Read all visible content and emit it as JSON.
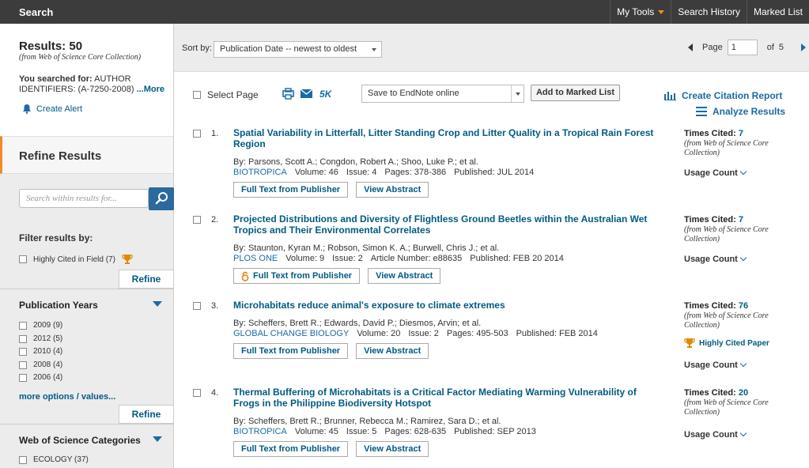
{
  "topbar": {
    "title": "Search",
    "nav": [
      {
        "label": "My Tools",
        "dropdown": true
      },
      {
        "label": "Search History",
        "dropdown": false
      },
      {
        "label": "Marked List",
        "dropdown": false
      }
    ]
  },
  "sidebar": {
    "results_title": "Results: 50",
    "results_source": "(from Web of Science Core Collection)",
    "searched_label": "You searched for:",
    "searched_query": "AUTHOR IDENTIFIERS: (A-7250-2008)",
    "more_label": "...More",
    "create_alert": "Create Alert",
    "refine_title": "Refine Results",
    "search_within_placeholder": "Search within results for...",
    "filter_title": "Filter results by:",
    "filter_items": [
      {
        "label": "Highly Cited in Field (7)",
        "checked": false
      }
    ],
    "refine_label": "Refine",
    "pub_years_title": "Publication Years",
    "pub_years": [
      {
        "label": "2009 (9)"
      },
      {
        "label": "2012 (5)"
      },
      {
        "label": "2010 (4)"
      },
      {
        "label": "2008 (4)"
      },
      {
        "label": "2006 (4)"
      }
    ],
    "more_options": "more options / values...",
    "categories_title": "Web of Science Categories",
    "categories": [
      {
        "label": "ECOLOGY (37)"
      }
    ]
  },
  "sortbar": {
    "label": "Sort by:",
    "selected": "Publication Date -- newest to oldest",
    "page_label": "Page",
    "page_value": "1",
    "of_label": "of",
    "total_pages": "5"
  },
  "toolbar": {
    "select_page": "Select Page",
    "fivek": "5K",
    "save_option": "Save to EndNote online",
    "add_marked": "Add to Marked List",
    "create_report": "Create Citation Report",
    "analyze": "Analyze Results"
  },
  "colors": {
    "link": "#005a84",
    "accent": "#f08a24",
    "topbar": "#3c3c3c"
  },
  "results": [
    {
      "num": "1.",
      "title": "Spatial Variability in Litterfall, Litter Standing Crop and Litter Quality in a Tropical Rain Forest Region",
      "authors": "By: Parsons, Scott A.; Congdon, Robert A.; Shoo, Luke P.; et al.",
      "journal": "BIOTROPICA",
      "details": [
        "Volume: 46",
        "Issue: 4",
        "Pages: 378-386",
        "Published: JUL 2014"
      ],
      "fulltext": "Full Text from Publisher",
      "abstract": "View Abstract",
      "open_access": false,
      "times_cited_label": "Times Cited:",
      "times_cited": "7",
      "cited_source": "(from Web of Science Core Collection)",
      "highly_cited": "",
      "usage": "Usage Count"
    },
    {
      "num": "2.",
      "title": "Projected Distributions and Diversity of Flightless Ground Beetles within the Australian Wet Tropics and Their Environmental Correlates",
      "authors": "By: Staunton, Kyran M.; Robson, Simon K. A.; Burwell, Chris J.; et al.",
      "journal": "PLOS ONE",
      "details": [
        "Volume: 9",
        "Issue: 2",
        "Article Number: e88635",
        "Published: FEB 20 2014"
      ],
      "fulltext": "Full Text from Publisher",
      "abstract": "View Abstract",
      "open_access": true,
      "times_cited_label": "Times Cited:",
      "times_cited": "7",
      "cited_source": "(from Web of Science Core Collection)",
      "highly_cited": "",
      "usage": "Usage Count"
    },
    {
      "num": "3.",
      "title": "Microhabitats reduce animal's exposure to climate extremes",
      "authors": "By: Scheffers, Brett R.; Edwards, David P.; Diesmos, Arvin; et al.",
      "journal": "GLOBAL CHANGE BIOLOGY",
      "details": [
        "Volume: 20",
        "Issue: 2",
        "Pages: 495-503",
        "Published: FEB 2014"
      ],
      "fulltext": "Full Text from Publisher",
      "abstract": "View Abstract",
      "open_access": false,
      "times_cited_label": "Times Cited:",
      "times_cited": "76",
      "cited_source": "(from Web of Science Core Collection)",
      "highly_cited": "Highly Cited Paper",
      "usage": "Usage Count"
    },
    {
      "num": "4.",
      "title": "Thermal Buffering of Microhabitats is a Critical Factor Mediating Warming Vulnerability of Frogs in the Philippine Biodiversity Hotspot",
      "authors": "By: Scheffers, Brett R.; Brunner, Rebecca M.; Ramirez, Sara D.; et al.",
      "journal": "BIOTROPICA",
      "details": [
        "Volume: 45",
        "Issue: 5",
        "Pages: 628-635",
        "Published: SEP 2013"
      ],
      "fulltext": "Full Text from Publisher",
      "abstract": "View Abstract",
      "open_access": false,
      "times_cited_label": "Times Cited:",
      "times_cited": "20",
      "cited_source": "(from Web of Science Core Collection)",
      "highly_cited": "",
      "usage": "Usage Count"
    }
  ]
}
